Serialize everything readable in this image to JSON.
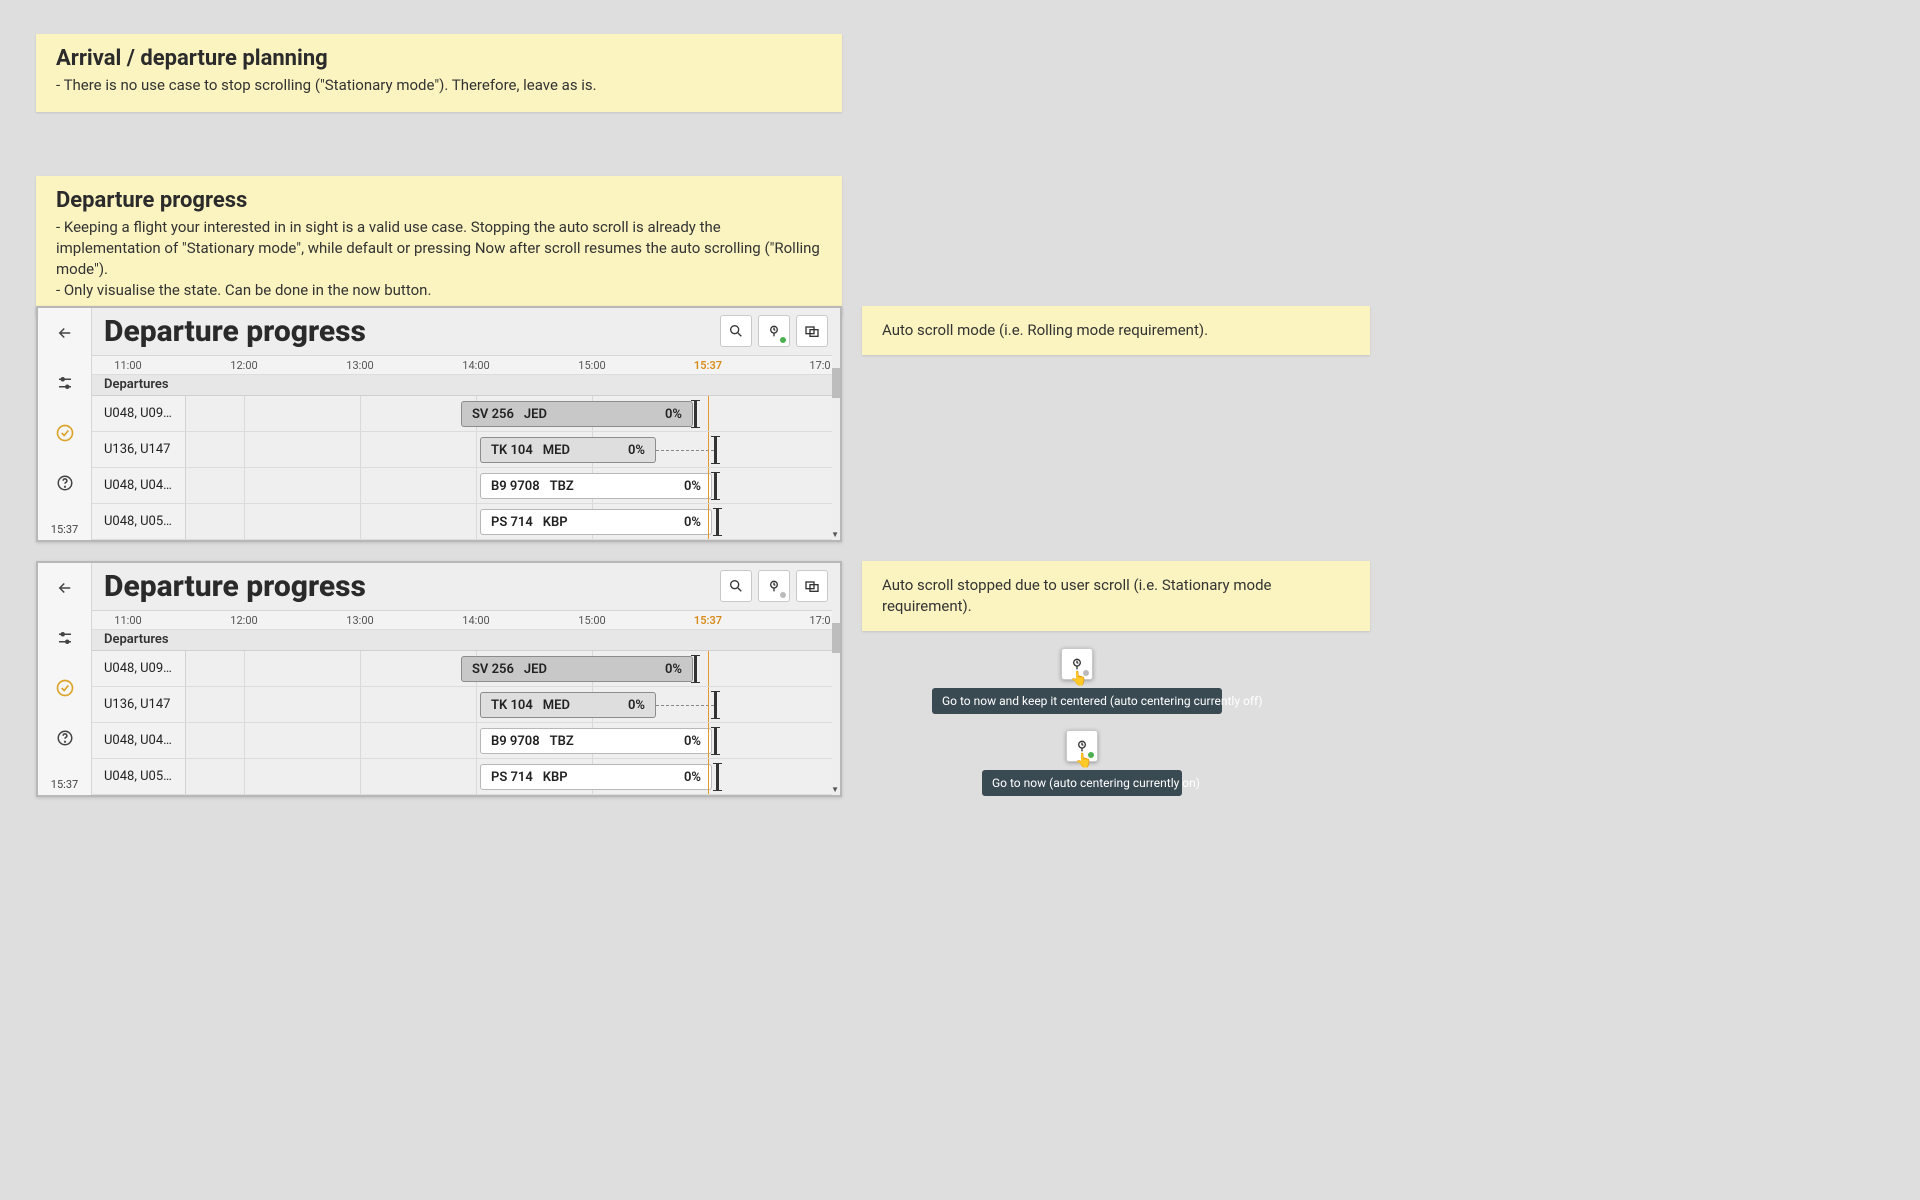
{
  "note1": {
    "title": "Arrival / departure planning",
    "line1": "- There is no use case to stop scrolling (\"Stationary mode\"). Therefore, leave as is."
  },
  "note2": {
    "title": "Departure progress",
    "line1": "- Keeping a flight your interested in in sight is a valid use case. Stopping the auto scroll is already the implementation of \"Stationary mode\", while default or pressing Now after scroll resumes the auto scrolling (\"Rolling mode\").",
    "line2": "- Only visualise the state. Can be done in the now button."
  },
  "side_note_a": "Auto scroll mode (i.e. Rolling mode requirement).",
  "side_note_b": "Auto scroll stopped due to user scroll (i.e. Stationary mode requirement).",
  "panel": {
    "title": "Departure progress",
    "section": "Departures",
    "now_label": "15:37",
    "rail_time": "15:37",
    "ticks": [
      "11:00",
      "12:00",
      "13:00",
      "14:00",
      "15:00",
      "17:0"
    ],
    "rows": [
      {
        "label": "U048, U09…",
        "flight": "SV  256",
        "dest": "JED",
        "pct": "0%",
        "style": "grey"
      },
      {
        "label": "U136, U147",
        "flight": "TK  104",
        "dest": "MED",
        "pct": "0%",
        "style": "light"
      },
      {
        "label": "U048, U04…",
        "flight": "B9  9708",
        "dest": "TBZ",
        "pct": "0%",
        "style": "white"
      },
      {
        "label": "U048, U05…",
        "flight": "PS  714",
        "dest": "KBP",
        "pct": "0%",
        "style": "white"
      }
    ]
  },
  "tooltip_off": "Go to now and keep it centered (auto centering currently off)",
  "tooltip_on": "Go to now (auto centering currently on)"
}
